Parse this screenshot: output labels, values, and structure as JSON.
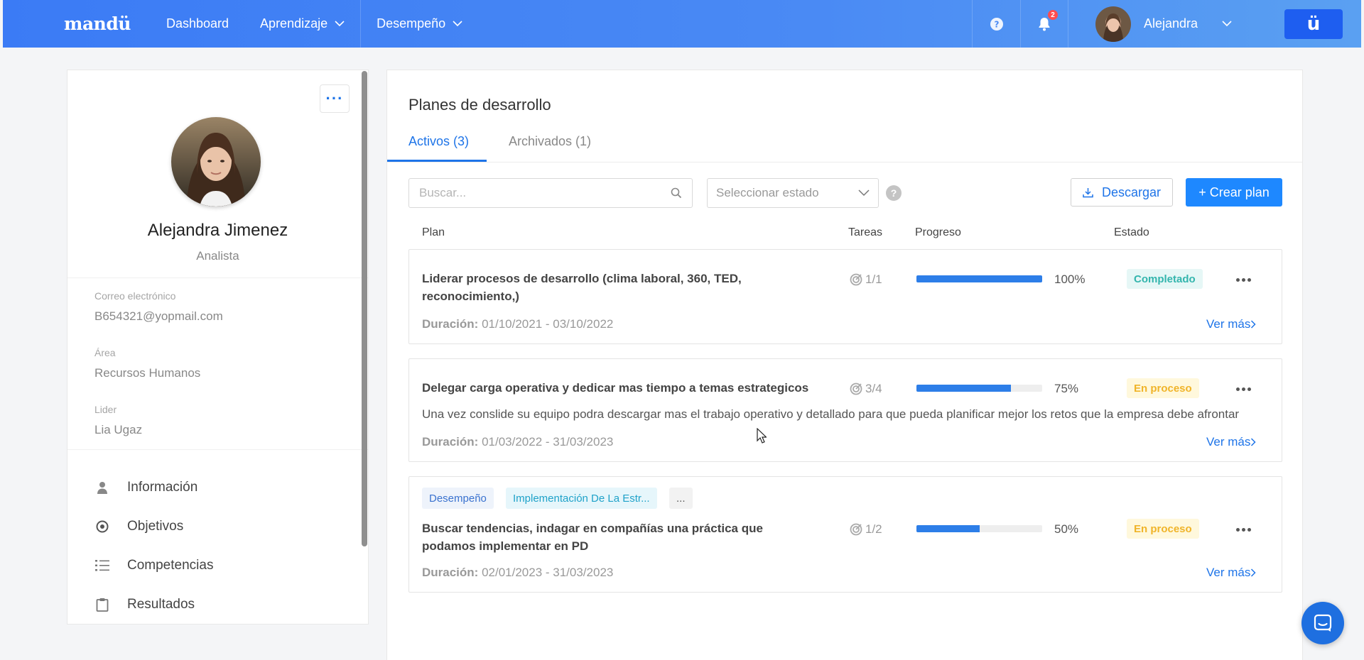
{
  "app": {
    "logo": "mandü",
    "colors": {
      "primary": "#1e74e8",
      "topbar": "#3b7bf5",
      "done": "#33b5ad",
      "in_progress": "#f0b429"
    }
  },
  "nav": {
    "items": [
      {
        "label": "Dashboard"
      },
      {
        "label": "Aprendizaje"
      },
      {
        "label": "Desempeño"
      }
    ],
    "notifications_count": "2",
    "user_name": "Alejandra",
    "brand_button": "ü"
  },
  "profile": {
    "name": "Alejandra Jimenez",
    "role": "Analista",
    "email_label": "Correo electrónico",
    "email": "B654321@yopmail.com",
    "area_label": "Área",
    "area": "Recursos Humanos",
    "leader_label": "Lider",
    "leader": "Lia Ugaz",
    "menu": [
      {
        "label": "Información",
        "icon": "user-icon"
      },
      {
        "label": "Objetivos",
        "icon": "target-icon"
      },
      {
        "label": "Competencias",
        "icon": "list-icon"
      },
      {
        "label": "Resultados",
        "icon": "clipboard-icon"
      }
    ]
  },
  "main": {
    "title": "Planes de desarrollo",
    "tabs": [
      {
        "label": "Activos (3)",
        "active": true
      },
      {
        "label": "Archivados (1)",
        "active": false
      }
    ],
    "search_placeholder": "Buscar...",
    "status_select": "Seleccionar estado",
    "download_label": "Descargar",
    "create_label": "+ Crear plan",
    "columns": {
      "plan": "Plan",
      "tasks": "Tareas",
      "progress": "Progreso",
      "status": "Estado"
    },
    "duration_label": "Duración:",
    "see_more": "Ver más",
    "plans": [
      {
        "title": "Liderar procesos de desarrollo (clima laboral, 360, TED, reconocimiento,)",
        "tasks": "1/1",
        "progress": 100,
        "progress_label": "100%",
        "status": "Completado",
        "duration": "01/10/2021 - 03/10/2022"
      },
      {
        "title": "Delegar carga operativa y dedicar mas tiempo a temas estrategicos",
        "description": "Una vez conslide su equipo podra descargar mas el trabajo operativo y detallado para que pueda planificar mejor los retos que la empresa debe afrontar",
        "tasks": "3/4",
        "progress": 75,
        "progress_label": "75%",
        "status": "En proceso",
        "duration": "01/03/2022 - 31/03/2023"
      },
      {
        "tags": [
          "Desempeño",
          "Implementación De La Estr...",
          "..."
        ],
        "title": "Buscar tendencias, indagar en compañías una práctica que podamos implementar en PD",
        "tasks": "1/2",
        "progress": 50,
        "progress_label": "50%",
        "status": "En proceso",
        "duration": "02/01/2023 - 31/03/2023"
      }
    ]
  }
}
